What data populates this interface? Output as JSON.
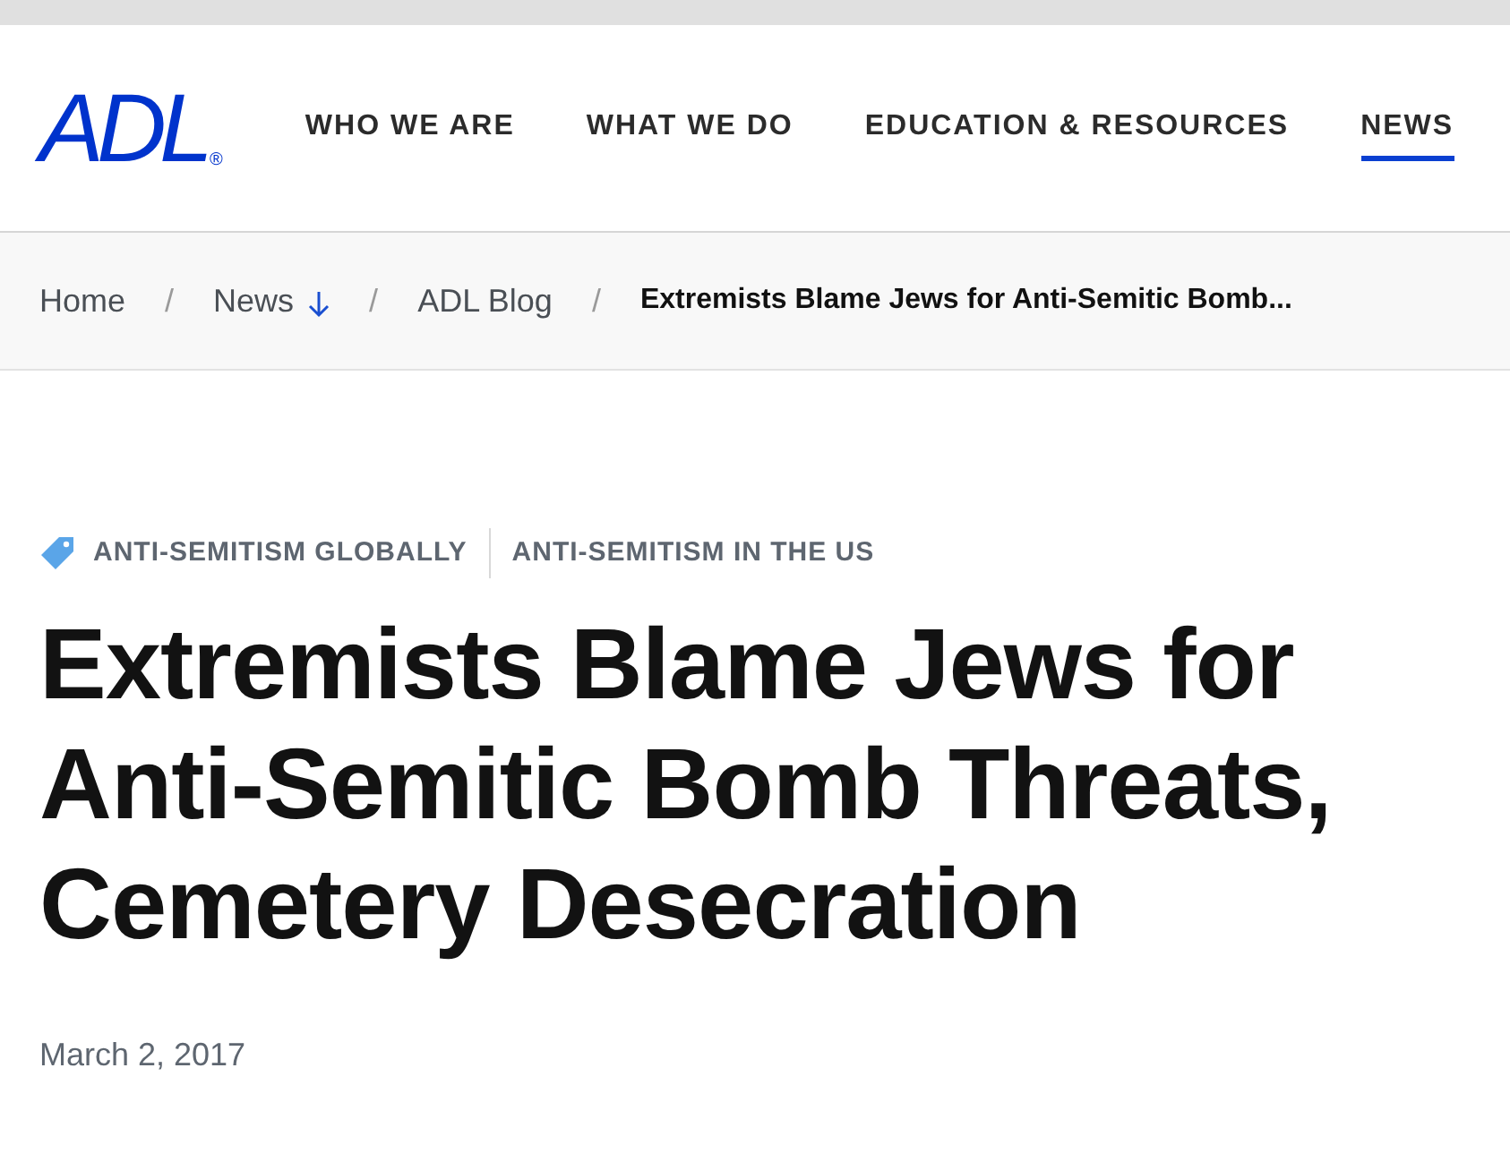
{
  "logo": {
    "text": "ADL",
    "mark": "®"
  },
  "nav": [
    {
      "label": "WHO WE ARE",
      "selected": false
    },
    {
      "label": "WHAT WE DO",
      "selected": false
    },
    {
      "label": "EDUCATION & RESOURCES",
      "selected": false
    },
    {
      "label": "NEWS",
      "selected": true
    }
  ],
  "breadcrumbs": [
    {
      "label": "Home",
      "kind": "link"
    },
    {
      "label": "News",
      "kind": "dropdown"
    },
    {
      "label": "ADL Blog",
      "kind": "link"
    },
    {
      "label": "Extremists Blame Jews for Anti-Semitic Bomb...",
      "kind": "current"
    }
  ],
  "breadcrumb_separator": "/",
  "tags": [
    "ANTI-SEMITISM GLOBALLY",
    "ANTI-SEMITISM IN THE US"
  ],
  "title": "Extremists Blame Jews for Anti-Semitic Bomb Threats, Cemetery Desecration",
  "date": "March 2, 2017"
}
